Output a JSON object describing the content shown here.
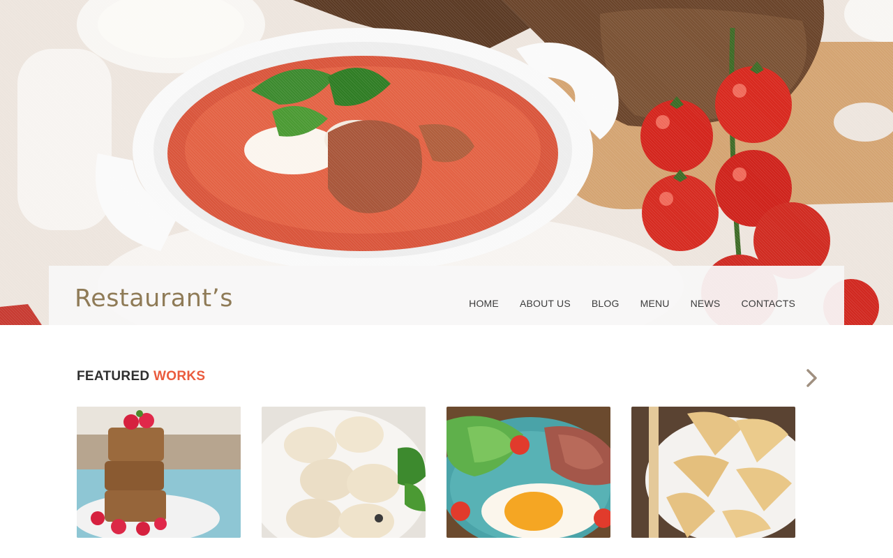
{
  "brand": {
    "logo_text": "Restaurant’s"
  },
  "nav": {
    "items": [
      {
        "label": "HOME"
      },
      {
        "label": "ABOUT US"
      },
      {
        "label": "BLOG"
      },
      {
        "label": "MENU"
      },
      {
        "label": "NEWS"
      },
      {
        "label": "CONTACTS"
      }
    ]
  },
  "hero": {
    "image": "tomato-soup-bowl-with-bread-and-cherry-tomatoes"
  },
  "featured": {
    "title_part1": "FEATURED",
    "title_part2": "WORKS",
    "next_icon": "chevron-right-icon",
    "items": [
      {
        "image": "oat-bars-with-raspberries"
      },
      {
        "image": "dumplings-in-bowl"
      },
      {
        "image": "fried-egg-with-beef-and-salad"
      },
      {
        "image": "crepes-on-plate"
      }
    ]
  },
  "colors": {
    "brand": "#8f7b57",
    "accent": "#ea5b3d",
    "nav_text": "#3b3b3b",
    "heading": "#2f2f2f"
  }
}
